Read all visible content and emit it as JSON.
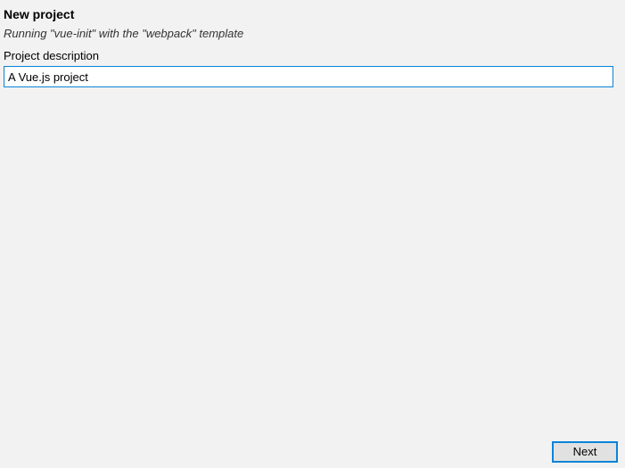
{
  "dialog": {
    "title": "New project",
    "subtitle": "Running \"vue-init\" with the \"webpack\" template",
    "field_label": "Project description",
    "field_value": "A Vue.js project"
  },
  "footer": {
    "next_label": "Next"
  }
}
